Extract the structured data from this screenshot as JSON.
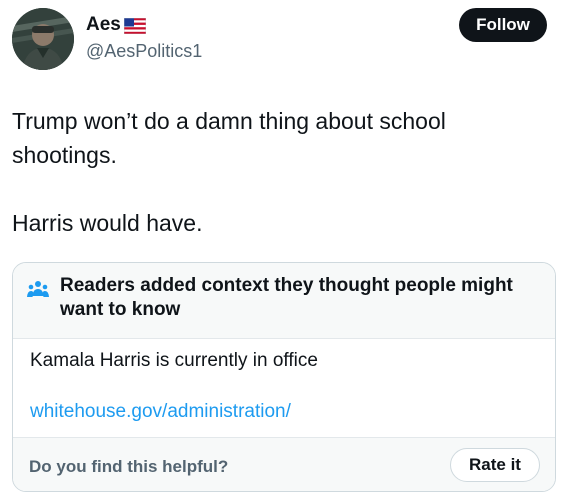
{
  "user": {
    "display_name": "Aes",
    "handle": "@AesPolitics1",
    "flag_icon": "us-flag-icon",
    "avatar_icon": "avatar"
  },
  "actions": {
    "follow_label": "Follow"
  },
  "tweet": {
    "paragraphs": [
      "Trump won’t do a damn thing about school shootings.",
      "Harris would have."
    ]
  },
  "community_note": {
    "icon": "people-icon",
    "title": "Readers added context they thought people might want to know",
    "body": "Kamala Harris is currently in office",
    "link_text": "whitehouse.gov/administration/",
    "helpful_question": "Do you find this helpful?",
    "rate_label": "Rate it"
  },
  "colors": {
    "text": "#0f1419",
    "secondary_text": "#536471",
    "link": "#1d9bf0",
    "border": "#cfd9de",
    "card_header_bg": "#f7f9f9",
    "follow_bg": "#0f1419"
  }
}
